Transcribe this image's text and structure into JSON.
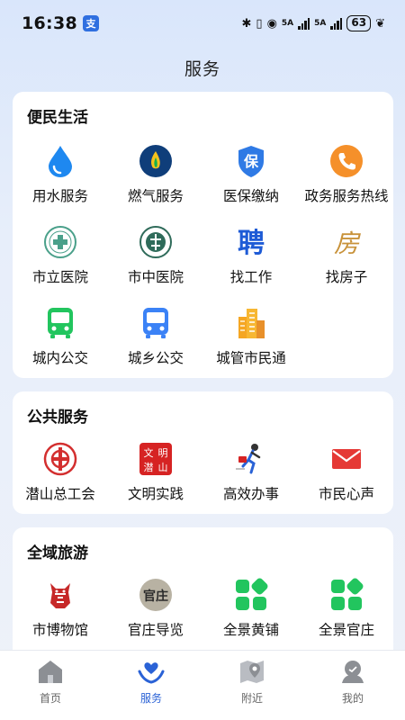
{
  "status_bar": {
    "time": "16:38",
    "app_badge": "支",
    "battery": "63",
    "net_5a_1": "5A",
    "net_5a_2": "5A",
    "hd": "HD"
  },
  "page": {
    "title": "服务"
  },
  "sections": [
    {
      "title": "便民生活",
      "items": [
        {
          "label": "用水服务",
          "icon": "water-drop-icon"
        },
        {
          "label": "燃气服务",
          "icon": "gas-flame-icon"
        },
        {
          "label": "医保缴纳",
          "icon": "medical-insurance-shield-icon",
          "glyph": "保"
        },
        {
          "label": "政务服务热线",
          "icon": "phone-hotline-icon"
        },
        {
          "label": "市立医院",
          "icon": "hospital-logo-icon"
        },
        {
          "label": "市中医院",
          "icon": "tcm-hospital-logo-icon"
        },
        {
          "label": "找工作",
          "icon": "job-recruit-icon",
          "glyph": "聘"
        },
        {
          "label": "找房子",
          "icon": "house-search-icon",
          "glyph": "房"
        },
        {
          "label": "城内公交",
          "icon": "city-bus-icon"
        },
        {
          "label": "城乡公交",
          "icon": "rural-bus-icon"
        },
        {
          "label": "城管市民通",
          "icon": "city-buildings-icon"
        }
      ]
    },
    {
      "title": "公共服务",
      "items": [
        {
          "label": "潜山总工会",
          "icon": "trade-union-logo-icon"
        },
        {
          "label": "文明实践",
          "icon": "civilization-practice-icon",
          "glyph_text": [
            "文",
            "明",
            "潜",
            "山"
          ]
        },
        {
          "label": "高效办事",
          "icon": "running-person-icon"
        },
        {
          "label": "市民心声",
          "icon": "mail-envelope-icon"
        }
      ]
    },
    {
      "title": "全域旅游",
      "items": [
        {
          "label": "市博物馆",
          "icon": "museum-logo-icon"
        },
        {
          "label": "官庄导览",
          "icon": "guanzhuang-logo-icon",
          "glyph": "官庄"
        },
        {
          "label": "全景黄铺",
          "icon": "app-grid-icon"
        },
        {
          "label": "全景官庄",
          "icon": "app-grid-icon"
        }
      ]
    }
  ],
  "bottom_nav": [
    {
      "label": "首页",
      "icon": "home-icon",
      "active": false
    },
    {
      "label": "服务",
      "icon": "heart-hands-icon",
      "active": true
    },
    {
      "label": "附近",
      "icon": "map-pin-icon",
      "active": false
    },
    {
      "label": "我的",
      "icon": "user-profile-icon",
      "active": false
    }
  ],
  "colors": {
    "accent_blue": "#2a62d6",
    "water_blue": "#1e88f0",
    "gas_navy": "#0f3e7a",
    "orange": "#f5902a",
    "green": "#22c55e",
    "red": "#e53935",
    "inactive_gray": "#8c8f94"
  }
}
